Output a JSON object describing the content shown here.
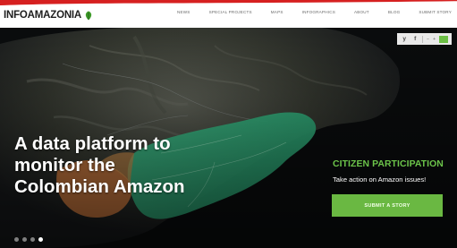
{
  "brand": {
    "name": "INFOAMAZONIA",
    "accent_color": "#6ab842",
    "logo_icon": "leaf-icon"
  },
  "nav": {
    "items": [
      "NEWS",
      "SPECIAL PROJECTS",
      "MAPS",
      "INFOGRAPHICS",
      "ABOUT",
      "BLOG",
      "SUBMIT STORY"
    ]
  },
  "share": {
    "twitter": "y",
    "facebook": "f",
    "zoom_out": "−",
    "zoom_in": "+"
  },
  "hero": {
    "headline_lines": [
      "A data platform to",
      "monitor the",
      "Colombian Amazon"
    ]
  },
  "citizen": {
    "title": "CITIZEN PARTICIPATION",
    "subtitle": "Take action on Amazon issues!",
    "button_label": "SUBMIT A STORY"
  },
  "carousel": {
    "slide_count": 4,
    "active_index": 3
  }
}
